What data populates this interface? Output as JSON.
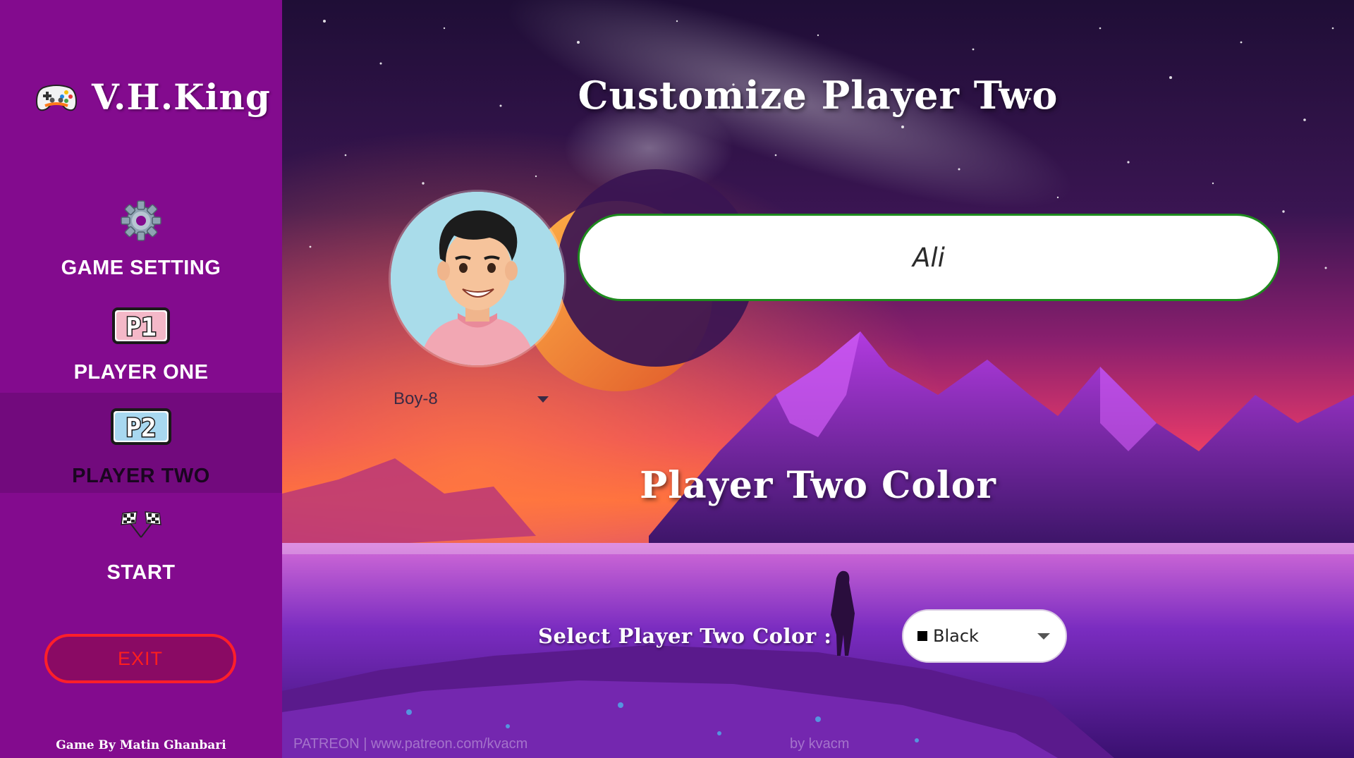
{
  "sidebar": {
    "brand": {
      "title": "V.H.King",
      "icon": "gamepad-icon"
    },
    "items": [
      {
        "id": "settings",
        "label": "GAME SETTING",
        "icon": "gear-icon",
        "active": false
      },
      {
        "id": "player-one",
        "label": "PLAYER ONE",
        "icon": "p1-badge-icon",
        "active": false
      },
      {
        "id": "player-two",
        "label": "PLAYER TWO",
        "icon": "p2-badge-icon",
        "active": true
      },
      {
        "id": "start",
        "label": "START",
        "icon": "checkered-flags-icon",
        "active": false
      }
    ],
    "exit_label": "EXIT",
    "credit": "Game By Matin Ghanbari",
    "colors": {
      "background": "#830b8e",
      "active": "#720a7d",
      "exit": "#ff1f2a"
    }
  },
  "main": {
    "title": "Customize Player Two",
    "avatar": {
      "selected": "Boy-8",
      "icon": "avatar-boy-icon"
    },
    "name_input": {
      "value": "Ali"
    },
    "color_section": {
      "title": "Player Two Color",
      "label": "Select Player Two Color :",
      "selected": "Black",
      "swatch": "#000000"
    },
    "watermark": {
      "left": "PATREON | www.patreon.com/kvacm",
      "center": "by kvacm"
    }
  }
}
